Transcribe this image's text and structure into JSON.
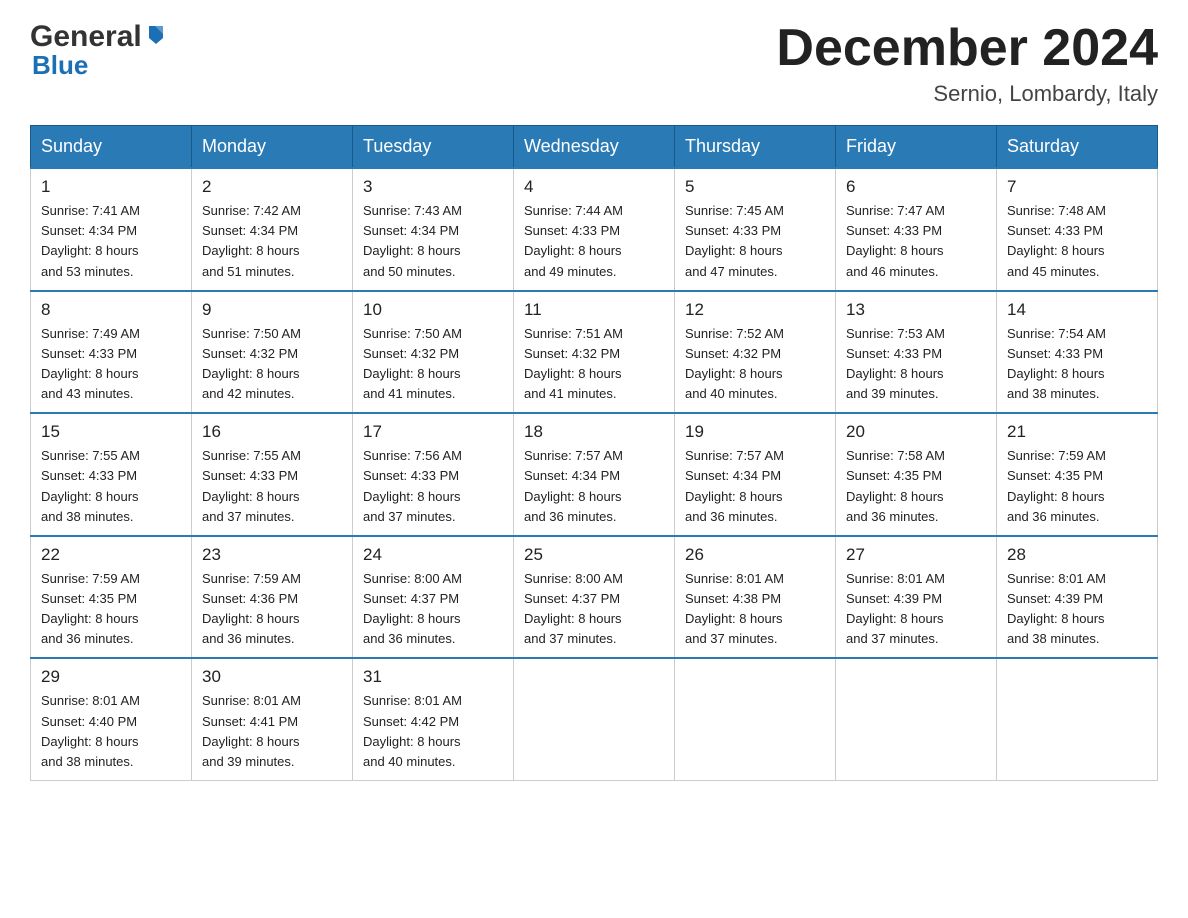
{
  "header": {
    "logo_general": "General",
    "logo_blue": "Blue",
    "month_title": "December 2024",
    "location": "Sernio, Lombardy, Italy"
  },
  "weekdays": [
    "Sunday",
    "Monday",
    "Tuesday",
    "Wednesday",
    "Thursday",
    "Friday",
    "Saturday"
  ],
  "weeks": [
    [
      {
        "day": "1",
        "sunrise": "7:41 AM",
        "sunset": "4:34 PM",
        "daylight": "8 hours and 53 minutes."
      },
      {
        "day": "2",
        "sunrise": "7:42 AM",
        "sunset": "4:34 PM",
        "daylight": "8 hours and 51 minutes."
      },
      {
        "day": "3",
        "sunrise": "7:43 AM",
        "sunset": "4:34 PM",
        "daylight": "8 hours and 50 minutes."
      },
      {
        "day": "4",
        "sunrise": "7:44 AM",
        "sunset": "4:33 PM",
        "daylight": "8 hours and 49 minutes."
      },
      {
        "day": "5",
        "sunrise": "7:45 AM",
        "sunset": "4:33 PM",
        "daylight": "8 hours and 47 minutes."
      },
      {
        "day": "6",
        "sunrise": "7:47 AM",
        "sunset": "4:33 PM",
        "daylight": "8 hours and 46 minutes."
      },
      {
        "day": "7",
        "sunrise": "7:48 AM",
        "sunset": "4:33 PM",
        "daylight": "8 hours and 45 minutes."
      }
    ],
    [
      {
        "day": "8",
        "sunrise": "7:49 AM",
        "sunset": "4:33 PM",
        "daylight": "8 hours and 43 minutes."
      },
      {
        "day": "9",
        "sunrise": "7:50 AM",
        "sunset": "4:32 PM",
        "daylight": "8 hours and 42 minutes."
      },
      {
        "day": "10",
        "sunrise": "7:50 AM",
        "sunset": "4:32 PM",
        "daylight": "8 hours and 41 minutes."
      },
      {
        "day": "11",
        "sunrise": "7:51 AM",
        "sunset": "4:32 PM",
        "daylight": "8 hours and 41 minutes."
      },
      {
        "day": "12",
        "sunrise": "7:52 AM",
        "sunset": "4:32 PM",
        "daylight": "8 hours and 40 minutes."
      },
      {
        "day": "13",
        "sunrise": "7:53 AM",
        "sunset": "4:33 PM",
        "daylight": "8 hours and 39 minutes."
      },
      {
        "day": "14",
        "sunrise": "7:54 AM",
        "sunset": "4:33 PM",
        "daylight": "8 hours and 38 minutes."
      }
    ],
    [
      {
        "day": "15",
        "sunrise": "7:55 AM",
        "sunset": "4:33 PM",
        "daylight": "8 hours and 38 minutes."
      },
      {
        "day": "16",
        "sunrise": "7:55 AM",
        "sunset": "4:33 PM",
        "daylight": "8 hours and 37 minutes."
      },
      {
        "day": "17",
        "sunrise": "7:56 AM",
        "sunset": "4:33 PM",
        "daylight": "8 hours and 37 minutes."
      },
      {
        "day": "18",
        "sunrise": "7:57 AM",
        "sunset": "4:34 PM",
        "daylight": "8 hours and 36 minutes."
      },
      {
        "day": "19",
        "sunrise": "7:57 AM",
        "sunset": "4:34 PM",
        "daylight": "8 hours and 36 minutes."
      },
      {
        "day": "20",
        "sunrise": "7:58 AM",
        "sunset": "4:35 PM",
        "daylight": "8 hours and 36 minutes."
      },
      {
        "day": "21",
        "sunrise": "7:59 AM",
        "sunset": "4:35 PM",
        "daylight": "8 hours and 36 minutes."
      }
    ],
    [
      {
        "day": "22",
        "sunrise": "7:59 AM",
        "sunset": "4:35 PM",
        "daylight": "8 hours and 36 minutes."
      },
      {
        "day": "23",
        "sunrise": "7:59 AM",
        "sunset": "4:36 PM",
        "daylight": "8 hours and 36 minutes."
      },
      {
        "day": "24",
        "sunrise": "8:00 AM",
        "sunset": "4:37 PM",
        "daylight": "8 hours and 36 minutes."
      },
      {
        "day": "25",
        "sunrise": "8:00 AM",
        "sunset": "4:37 PM",
        "daylight": "8 hours and 37 minutes."
      },
      {
        "day": "26",
        "sunrise": "8:01 AM",
        "sunset": "4:38 PM",
        "daylight": "8 hours and 37 minutes."
      },
      {
        "day": "27",
        "sunrise": "8:01 AM",
        "sunset": "4:39 PM",
        "daylight": "8 hours and 37 minutes."
      },
      {
        "day": "28",
        "sunrise": "8:01 AM",
        "sunset": "4:39 PM",
        "daylight": "8 hours and 38 minutes."
      }
    ],
    [
      {
        "day": "29",
        "sunrise": "8:01 AM",
        "sunset": "4:40 PM",
        "daylight": "8 hours and 38 minutes."
      },
      {
        "day": "30",
        "sunrise": "8:01 AM",
        "sunset": "4:41 PM",
        "daylight": "8 hours and 39 minutes."
      },
      {
        "day": "31",
        "sunrise": "8:01 AM",
        "sunset": "4:42 PM",
        "daylight": "8 hours and 40 minutes."
      },
      null,
      null,
      null,
      null
    ]
  ],
  "labels": {
    "sunrise": "Sunrise:",
    "sunset": "Sunset:",
    "daylight": "Daylight:"
  }
}
